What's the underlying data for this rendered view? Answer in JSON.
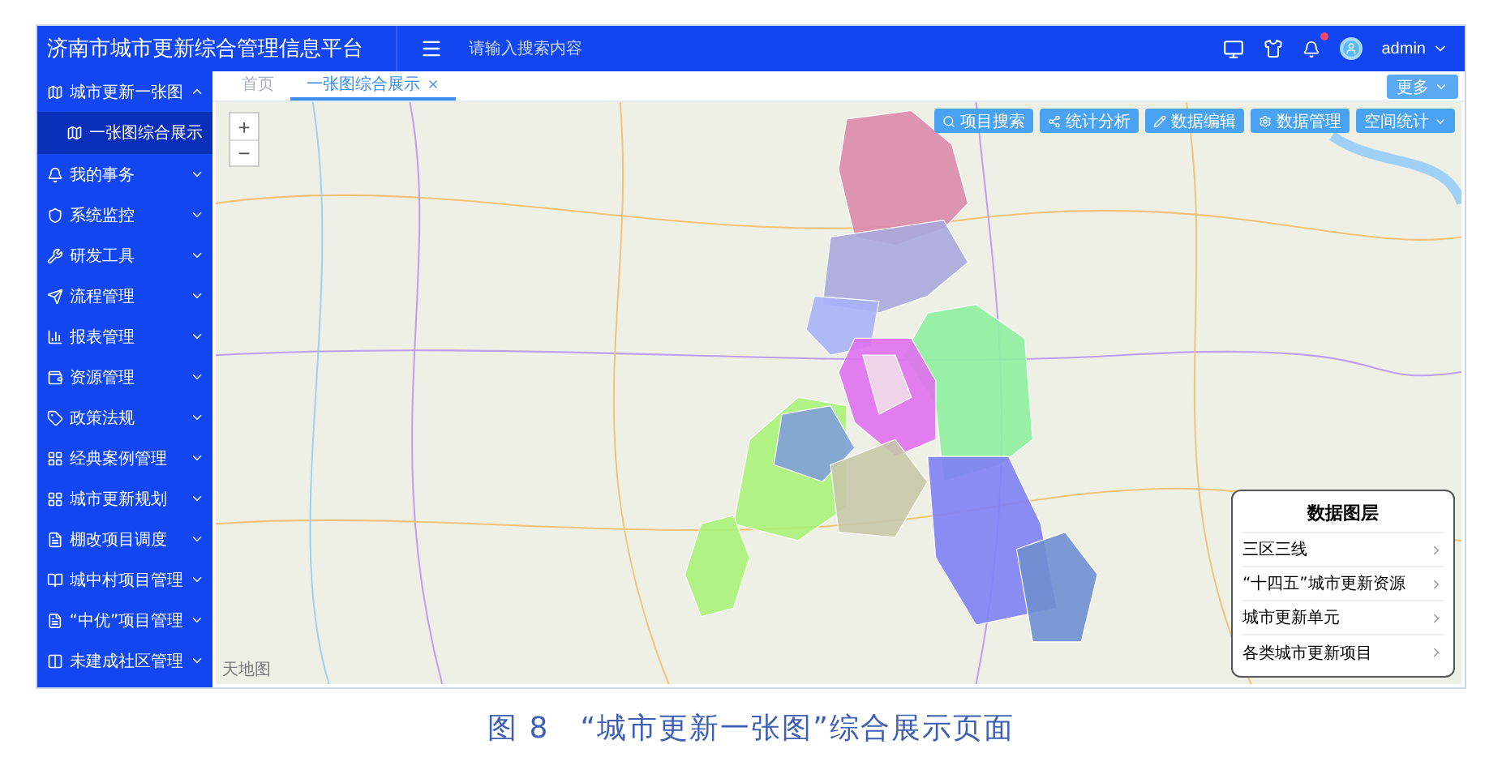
{
  "header": {
    "title": "济南市城市更新综合管理信息平台",
    "search": {
      "placeholder": "请输入搜索内容"
    },
    "notifications": {
      "has_alert": true
    },
    "user": {
      "name": "admin"
    }
  },
  "sidebar": {
    "items": [
      {
        "label": "城市更新一张图",
        "expanded": true,
        "children": [
          {
            "label": "一张图综合展示",
            "selected": true
          }
        ]
      },
      {
        "label": "我的事务",
        "expanded": false
      },
      {
        "label": "系统监控",
        "expanded": false
      },
      {
        "label": "研发工具",
        "expanded": false
      },
      {
        "label": "流程管理",
        "expanded": false
      },
      {
        "label": "报表管理",
        "expanded": false
      },
      {
        "label": "资源管理",
        "expanded": false
      },
      {
        "label": "政策法规",
        "expanded": false
      },
      {
        "label": "经典案例管理",
        "expanded": false
      },
      {
        "label": "城市更新规划",
        "expanded": false
      },
      {
        "label": "棚改项目调度",
        "expanded": false
      },
      {
        "label": "城中村项目管理",
        "expanded": false
      },
      {
        "label": "“中优”项目管理",
        "expanded": false
      },
      {
        "label": "未建成社区管理",
        "expanded": false
      }
    ]
  },
  "tabs": [
    {
      "label": "首页",
      "selected": false,
      "closable": false
    },
    {
      "label": "一张图综合展示",
      "selected": true,
      "closable": true
    }
  ],
  "more_button": {
    "label": "更多"
  },
  "map": {
    "toolbar": [
      {
        "label": "项目搜索"
      },
      {
        "label": "统计分析"
      },
      {
        "label": "数据编辑"
      },
      {
        "label": "数据管理"
      },
      {
        "label": "空间统计"
      }
    ],
    "zoom": {
      "in": "+",
      "out": "−"
    },
    "attribution": "天地图",
    "layers_panel": {
      "title": "数据图层",
      "items": [
        {
          "label": "三区三线"
        },
        {
          "label": "“十四五”城市更新资源"
        },
        {
          "label": "城市更新单元"
        },
        {
          "label": "各类城市更新项目"
        }
      ]
    }
  },
  "caption": "图 8　“城市更新一张图”综合展示页面"
}
